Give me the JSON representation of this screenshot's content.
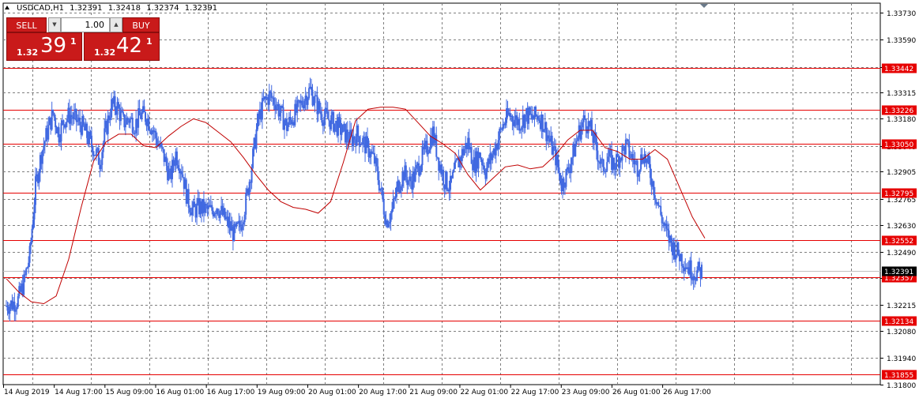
{
  "header": {
    "symbol": "USDCAD,H1",
    "open": "1.32391",
    "high": "1.32418",
    "low": "1.32374",
    "close": "1.32391"
  },
  "trade_panel": {
    "sell_label": "SELL",
    "buy_label": "BUY",
    "volume": "1.00",
    "sell_price_prefix": "1.32",
    "sell_price_big": "39",
    "sell_price_sup": "1",
    "buy_price_prefix": "1.32",
    "buy_price_big": "42",
    "buy_price_sup": "1"
  },
  "colors": {
    "candles": "#4169e1",
    "moving_average": "#c00000",
    "level_lines": "#e60000",
    "level_label_bg": "#e60000",
    "current_price_label_bg": "#000000",
    "grid": "#7f7f7f"
  },
  "chart_data": {
    "type": "candlestick",
    "timeframe": "H1",
    "y_axis_ticks": [
      "1.33730",
      "1.33590",
      "1.33450",
      "1.33315",
      "1.33180",
      "1.33040",
      "1.32905",
      "1.32765",
      "1.32630",
      "1.32490",
      "1.32355",
      "1.32215",
      "1.32080",
      "1.31940",
      "1.31800"
    ],
    "ylim": [
      1.318,
      1.3378
    ],
    "x_axis_ticks": [
      "14 Aug 2019",
      "14 Aug 17:00",
      "15 Aug 09:00",
      "16 Aug 01:00",
      "16 Aug 17:00",
      "19 Aug 09:00",
      "20 Aug 01:00",
      "20 Aug 17:00",
      "21 Aug 09:00",
      "22 Aug 01:00",
      "22 Aug 17:00",
      "23 Aug 09:00",
      "26 Aug 01:00",
      "26 Aug 17:00"
    ],
    "horizontal_levels": [
      "1.33442",
      "1.33226",
      "1.33050",
      "1.32795",
      "1.32552",
      "1.32357",
      "1.32134",
      "1.31855"
    ],
    "current_price": "1.32391",
    "close_path": [
      1.3221,
      1.3222,
      1.3224,
      1.3233,
      1.3247,
      1.3283,
      1.33,
      1.3311,
      1.3321,
      1.331,
      1.3318,
      1.332,
      1.3317,
      1.3314,
      1.3308,
      1.3302,
      1.3296,
      1.3312,
      1.3325,
      1.3324,
      1.3316,
      1.3318,
      1.3315,
      1.332,
      1.3319,
      1.3313,
      1.3305,
      1.3298,
      1.3287,
      1.33,
      1.3292,
      1.3276,
      1.327,
      1.3272,
      1.3271,
      1.327,
      1.3273,
      1.3268,
      1.3263,
      1.3258,
      1.3262,
      1.3275,
      1.3294,
      1.3316,
      1.3326,
      1.333,
      1.3327,
      1.332,
      1.3314,
      1.3319,
      1.3323,
      1.3329,
      1.3333,
      1.3326,
      1.332,
      1.3318,
      1.3316,
      1.3313,
      1.331,
      1.3307,
      1.331,
      1.3306,
      1.3302,
      1.3296,
      1.3282,
      1.3265,
      1.327,
      1.3283,
      1.329,
      1.3285,
      1.3289,
      1.3297,
      1.3303,
      1.3311,
      1.3296,
      1.3286,
      1.3283,
      1.3293,
      1.33,
      1.3306,
      1.3294,
      1.33,
      1.3291,
      1.3298,
      1.3306,
      1.3315,
      1.332,
      1.3318,
      1.3316,
      1.332,
      1.3318,
      1.332,
      1.3315,
      1.3306,
      1.3298,
      1.3284,
      1.329,
      1.33,
      1.3311,
      1.3318,
      1.3312,
      1.3302,
      1.3292,
      1.3298,
      1.3294,
      1.3299,
      1.3304,
      1.3298,
      1.3293,
      1.33,
      1.3292,
      1.328,
      1.3268,
      1.3258,
      1.3252,
      1.3248,
      1.3244,
      1.324,
      1.3238,
      1.3239
    ],
    "moving_average_path": [
      1.3235,
      1.3228,
      1.3223,
      1.3222,
      1.3226,
      1.3245,
      1.3272,
      1.3296,
      1.3306,
      1.331,
      1.331,
      1.3304,
      1.3303,
      1.3309,
      1.3314,
      1.3318,
      1.3316,
      1.3311,
      1.3306,
      1.3298,
      1.3289,
      1.3281,
      1.3275,
      1.3272,
      1.3271,
      1.3269,
      1.3275,
      1.3295,
      1.3317,
      1.3323,
      1.3324,
      1.3324,
      1.3323,
      1.3316,
      1.3309,
      1.3305,
      1.33,
      1.3289,
      1.3281,
      1.3287,
      1.3293,
      1.3294,
      1.3292,
      1.3293,
      1.3299,
      1.3307,
      1.3312,
      1.3312,
      1.3303,
      1.3301,
      1.3297,
      1.3297,
      1.3302,
      1.3297,
      1.3282,
      1.3267,
      1.3256
    ]
  }
}
